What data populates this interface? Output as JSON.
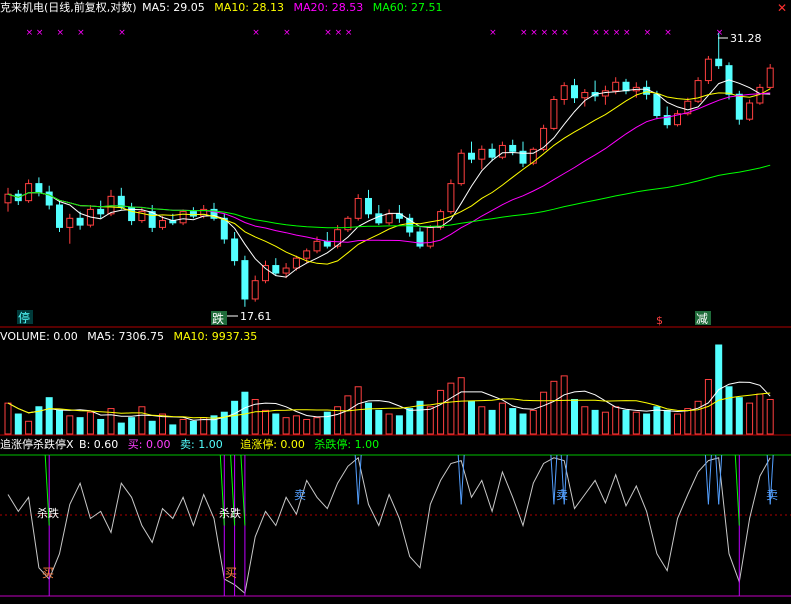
{
  "main": {
    "title": "克来机电(日线,前复权,对数)",
    "ma5": "MA5: 29.05",
    "ma10": "MA10: 28.13",
    "ma20": "MA20: 28.53",
    "ma60": "MA60: 27.51",
    "high_label": "31.28",
    "low_label": "17.61",
    "markers": {
      "ting": "停",
      "die": "跌",
      "jian": "减",
      "dollar": "$"
    }
  },
  "volume": {
    "label": "VOLUME: 0.00",
    "ma5": "MA5: 7306.75",
    "ma10": "MA10: 9937.35"
  },
  "indicator": {
    "name": "追涨停杀跌停X",
    "b": "B: 0.60",
    "buy": "买: 0.00",
    "sell": "卖: 1.00",
    "zhui": "追涨停: 0.00",
    "sha": "杀跌停: 1.00",
    "sha_label": "杀跌",
    "buy_label": "买",
    "sell_label": "卖"
  },
  "colors": {
    "up": "#ff4040",
    "down": "#54ffff",
    "ma5": "#ffffff",
    "ma10": "#ffff00",
    "ma20": "#ff00ff",
    "ma60": "#00ff00",
    "axis": "#b00000"
  },
  "chart_data": [
    {
      "type": "candlestick",
      "title": "克来机电(日线,前复权,对数)",
      "ylim": [
        17.61,
        31.28
      ],
      "ohlc": [
        [
          21.9,
          22.6,
          21.5,
          22.3
        ],
        [
          22.3,
          22.5,
          21.8,
          22.0
        ],
        [
          22.0,
          23.0,
          21.9,
          22.8
        ],
        [
          22.8,
          23.1,
          22.2,
          22.4
        ],
        [
          22.4,
          22.7,
          21.6,
          21.8
        ],
        [
          21.8,
          22.0,
          20.6,
          20.8
        ],
        [
          20.8,
          21.4,
          20.1,
          21.2
        ],
        [
          21.2,
          21.5,
          20.7,
          20.9
        ],
        [
          20.9,
          21.8,
          20.8,
          21.6
        ],
        [
          21.6,
          22.0,
          21.2,
          21.4
        ],
        [
          21.4,
          22.5,
          21.3,
          22.2
        ],
        [
          22.2,
          22.6,
          21.6,
          21.7
        ],
        [
          21.7,
          21.9,
          20.9,
          21.1
        ],
        [
          21.1,
          21.7,
          21.0,
          21.5
        ],
        [
          21.5,
          21.8,
          20.6,
          20.8
        ],
        [
          20.8,
          21.3,
          20.7,
          21.1
        ],
        [
          21.1,
          21.4,
          20.9,
          21.0
        ],
        [
          21.0,
          21.6,
          20.9,
          21.5
        ],
        [
          21.5,
          21.7,
          21.2,
          21.3
        ],
        [
          21.3,
          21.8,
          21.2,
          21.6
        ],
        [
          21.6,
          21.9,
          21.1,
          21.2
        ],
        [
          21.2,
          21.4,
          20.1,
          20.3
        ],
        [
          20.3,
          20.6,
          19.2,
          19.4
        ],
        [
          19.4,
          19.6,
          17.61,
          17.9
        ],
        [
          17.9,
          18.8,
          17.8,
          18.6
        ],
        [
          18.6,
          19.4,
          18.5,
          19.2
        ],
        [
          19.2,
          19.5,
          18.8,
          18.9
        ],
        [
          18.9,
          19.3,
          18.7,
          19.1
        ],
        [
          19.1,
          19.6,
          19.0,
          19.5
        ],
        [
          19.5,
          19.9,
          19.3,
          19.8
        ],
        [
          19.8,
          20.4,
          19.7,
          20.2
        ],
        [
          20.2,
          20.6,
          19.9,
          20.0
        ],
        [
          20.0,
          20.9,
          19.9,
          20.7
        ],
        [
          20.7,
          21.3,
          20.6,
          21.2
        ],
        [
          21.2,
          22.3,
          21.1,
          22.1
        ],
        [
          22.1,
          22.5,
          21.2,
          21.4
        ],
        [
          21.4,
          21.8,
          20.9,
          21.0
        ],
        [
          21.0,
          21.6,
          20.9,
          21.4
        ],
        [
          21.4,
          21.8,
          21.0,
          21.2
        ],
        [
          21.2,
          21.4,
          20.4,
          20.6
        ],
        [
          20.6,
          20.8,
          19.9,
          20.0
        ],
        [
          20.0,
          20.9,
          19.9,
          20.8
        ],
        [
          20.8,
          21.6,
          20.7,
          21.5
        ],
        [
          21.5,
          23.0,
          21.4,
          22.8
        ],
        [
          22.8,
          24.5,
          22.7,
          24.3
        ],
        [
          24.3,
          24.9,
          23.8,
          24.0
        ],
        [
          24.0,
          24.7,
          23.5,
          24.5
        ],
        [
          24.5,
          24.8,
          23.9,
          24.1
        ],
        [
          24.1,
          24.9,
          24.0,
          24.7
        ],
        [
          24.7,
          25.0,
          24.2,
          24.4
        ],
        [
          24.4,
          24.9,
          23.6,
          23.8
        ],
        [
          23.8,
          24.6,
          23.7,
          24.5
        ],
        [
          24.5,
          25.8,
          24.4,
          25.6
        ],
        [
          25.6,
          27.4,
          25.5,
          27.2
        ],
        [
          27.2,
          28.2,
          26.9,
          28.0
        ],
        [
          28.0,
          28.4,
          27.0,
          27.3
        ],
        [
          27.3,
          27.8,
          26.8,
          27.6
        ],
        [
          27.6,
          28.3,
          27.1,
          27.4
        ],
        [
          27.4,
          28.0,
          26.9,
          27.7
        ],
        [
          27.7,
          28.5,
          27.5,
          28.2
        ],
        [
          28.2,
          28.4,
          27.5,
          27.7
        ],
        [
          27.7,
          28.2,
          27.3,
          27.9
        ],
        [
          27.9,
          28.3,
          27.2,
          27.5
        ],
        [
          27.5,
          27.7,
          26.1,
          26.3
        ],
        [
          26.3,
          26.8,
          25.6,
          25.8
        ],
        [
          25.8,
          26.6,
          25.7,
          26.4
        ],
        [
          26.4,
          27.3,
          26.3,
          27.1
        ],
        [
          27.1,
          28.5,
          27.0,
          28.3
        ],
        [
          28.3,
          29.8,
          28.1,
          29.6
        ],
        [
          29.6,
          31.28,
          29.0,
          29.2
        ],
        [
          29.2,
          29.4,
          27.2,
          27.5
        ],
        [
          27.5,
          27.7,
          25.8,
          26.1
        ],
        [
          26.1,
          27.2,
          26.0,
          27.0
        ],
        [
          27.0,
          28.1,
          26.9,
          27.9
        ],
        [
          27.9,
          29.3,
          27.8,
          29.05
        ]
      ],
      "series": [
        {
          "name": "MA5",
          "current": 29.05
        },
        {
          "name": "MA10",
          "current": 28.13
        },
        {
          "name": "MA20",
          "current": 28.53
        },
        {
          "name": "MA60",
          "current": 27.51
        }
      ]
    },
    {
      "type": "bar",
      "title": "VOLUME",
      "values": [
        34,
        22,
        14,
        30,
        40,
        26,
        20,
        18,
        24,
        16,
        28,
        12,
        18,
        30,
        14,
        22,
        10,
        16,
        14,
        18,
        20,
        24,
        36,
        46,
        38,
        26,
        22,
        18,
        20,
        16,
        18,
        24,
        30,
        42,
        52,
        34,
        26,
        22,
        20,
        28,
        36,
        30,
        48,
        56,
        62,
        36,
        30,
        26,
        34,
        28,
        22,
        26,
        46,
        58,
        64,
        38,
        30,
        26,
        24,
        30,
        26,
        24,
        22,
        30,
        26,
        22,
        28,
        36,
        60,
        98,
        52,
        40,
        34,
        44,
        38
      ],
      "series": [
        {
          "name": "VOLUME",
          "current": 0.0
        },
        {
          "name": "MA5",
          "current": 7306.75
        },
        {
          "name": "MA10",
          "current": 9937.35
        }
      ]
    },
    {
      "type": "line",
      "title": "追涨停杀跌停X",
      "ylim": [
        0,
        1
      ],
      "values": [
        0.72,
        0.6,
        0.7,
        0.2,
        0.12,
        0.3,
        0.65,
        0.8,
        0.55,
        0.6,
        0.45,
        0.8,
        0.7,
        0.5,
        0.38,
        0.62,
        0.55,
        0.7,
        0.5,
        0.72,
        0.55,
        0.12,
        0.08,
        0.02,
        0.42,
        0.6,
        0.5,
        0.7,
        0.58,
        0.82,
        0.7,
        0.62,
        0.8,
        0.92,
        0.98,
        0.65,
        0.5,
        0.72,
        0.55,
        0.28,
        0.2,
        0.65,
        0.82,
        0.94,
        0.96,
        0.7,
        0.82,
        0.6,
        0.88,
        0.7,
        0.5,
        0.8,
        0.94,
        0.98,
        0.96,
        0.62,
        0.72,
        0.82,
        0.66,
        0.86,
        0.64,
        0.78,
        0.6,
        0.3,
        0.18,
        0.55,
        0.72,
        0.88,
        0.96,
        0.98,
        0.3,
        0.1,
        0.55,
        0.85,
        0.98
      ],
      "series": [
        {
          "name": "B",
          "current": 0.6
        },
        {
          "name": "买",
          "current": 0.0
        },
        {
          "name": "卖",
          "current": 1.0
        },
        {
          "name": "追涨停",
          "current": 0.0
        },
        {
          "name": "杀跌停",
          "current": 1.0
        }
      ]
    }
  ]
}
